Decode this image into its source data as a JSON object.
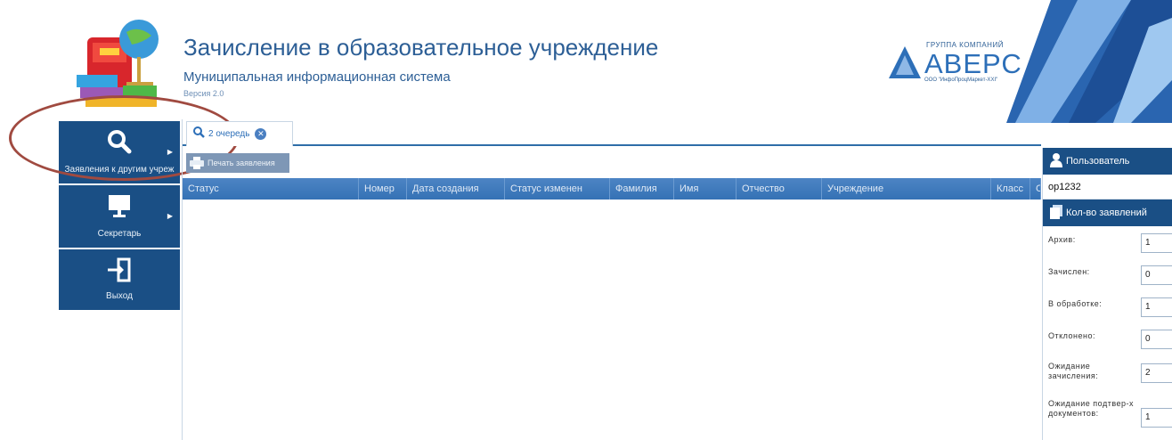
{
  "header": {
    "title": "Зачисление в образовательное учреждение",
    "subtitle": "Муниципальная информационная система",
    "version": "Версия 2.0",
    "brand": {
      "group_label": "ГРУППА КОМПАНИЙ",
      "name": "АВЕРС",
      "sub": "ООО \"ИнфоПроцМаркет-XXI\""
    }
  },
  "nav": {
    "items": [
      {
        "label": "Заявления к другим учреж",
        "icon": "search-icon",
        "has_submenu": true
      },
      {
        "label": "Секретарь",
        "icon": "monitor-icon",
        "has_submenu": true
      },
      {
        "label": "Выход",
        "icon": "exit-door-icon",
        "has_submenu": false
      }
    ]
  },
  "tabs": [
    {
      "label": "2 очередь",
      "icon": "search-icon",
      "closable": true
    }
  ],
  "toolbar": {
    "print_label": "Печать заявления"
  },
  "grid": {
    "columns": [
      "Статус",
      "Номер",
      "Дата создания",
      "Статус изменен",
      "Фамилия",
      "Имя",
      "Отчество",
      "Учреждение",
      "Класс",
      "Сп"
    ],
    "rows": []
  },
  "right_panel": {
    "user_header": "Пользователь",
    "user_value": "ор1232",
    "counts_header": "Кол-во заявлений",
    "counts": [
      {
        "label": "Архив:",
        "value": "1"
      },
      {
        "label": "Зачислен:",
        "value": "0"
      },
      {
        "label": "В обработке:",
        "value": "1"
      },
      {
        "label": "Отклонено:",
        "value": "0"
      },
      {
        "label": "Ожидание зачисления:",
        "value": "2"
      },
      {
        "label": "Ожидание подтвер-х документов:",
        "value": "1"
      }
    ]
  },
  "colors": {
    "nav_bg": "#1a4f85",
    "grid_header": "#3f7bbf",
    "title": "#2d5f96",
    "highlight_ring": "#a04a40"
  }
}
